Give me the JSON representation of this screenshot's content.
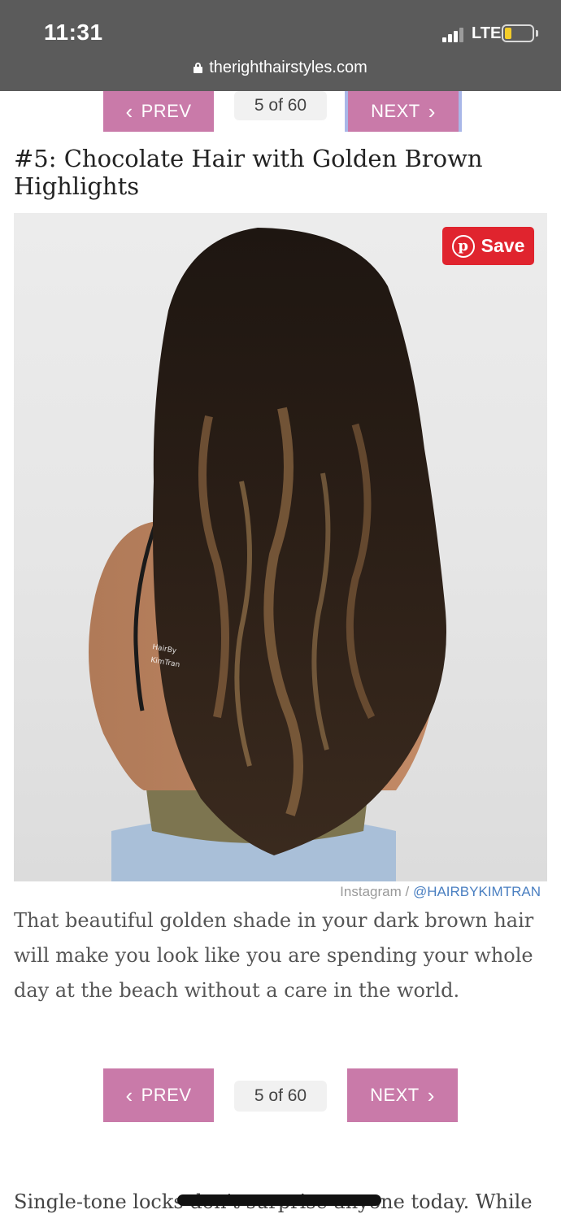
{
  "status_bar": {
    "time": "11:31",
    "network": "LTE",
    "battery_level": 0.25,
    "url": "therighthairstyles.com"
  },
  "pager": {
    "prev_label": "PREV",
    "next_label": "NEXT",
    "count": "5 of 60"
  },
  "article": {
    "title": "#5: Chocolate Hair with Golden Brown Highlights",
    "save_label": "Save",
    "credit_source": "Instagram / ",
    "credit_handle": "@HAIRBYKIMTRAN",
    "watermark": "HairBy KimTran",
    "paragraph": "That beautiful golden shade in your dark brown hair will make you look like you are spending your whole day at the beach without a care in the world.",
    "next_paragraph_start": "Single-tone locks don't surprise anyone today. While"
  },
  "colors": {
    "status_bg": "#5b5b5b",
    "pager_button": "#c97aa9",
    "pinterest_red": "#e0242e",
    "credit_link": "#4a7fc1"
  },
  "icons": [
    "lock-icon",
    "signal-icon",
    "battery-icon",
    "chevron-left-icon",
    "chevron-right-icon",
    "pinterest-icon"
  ]
}
